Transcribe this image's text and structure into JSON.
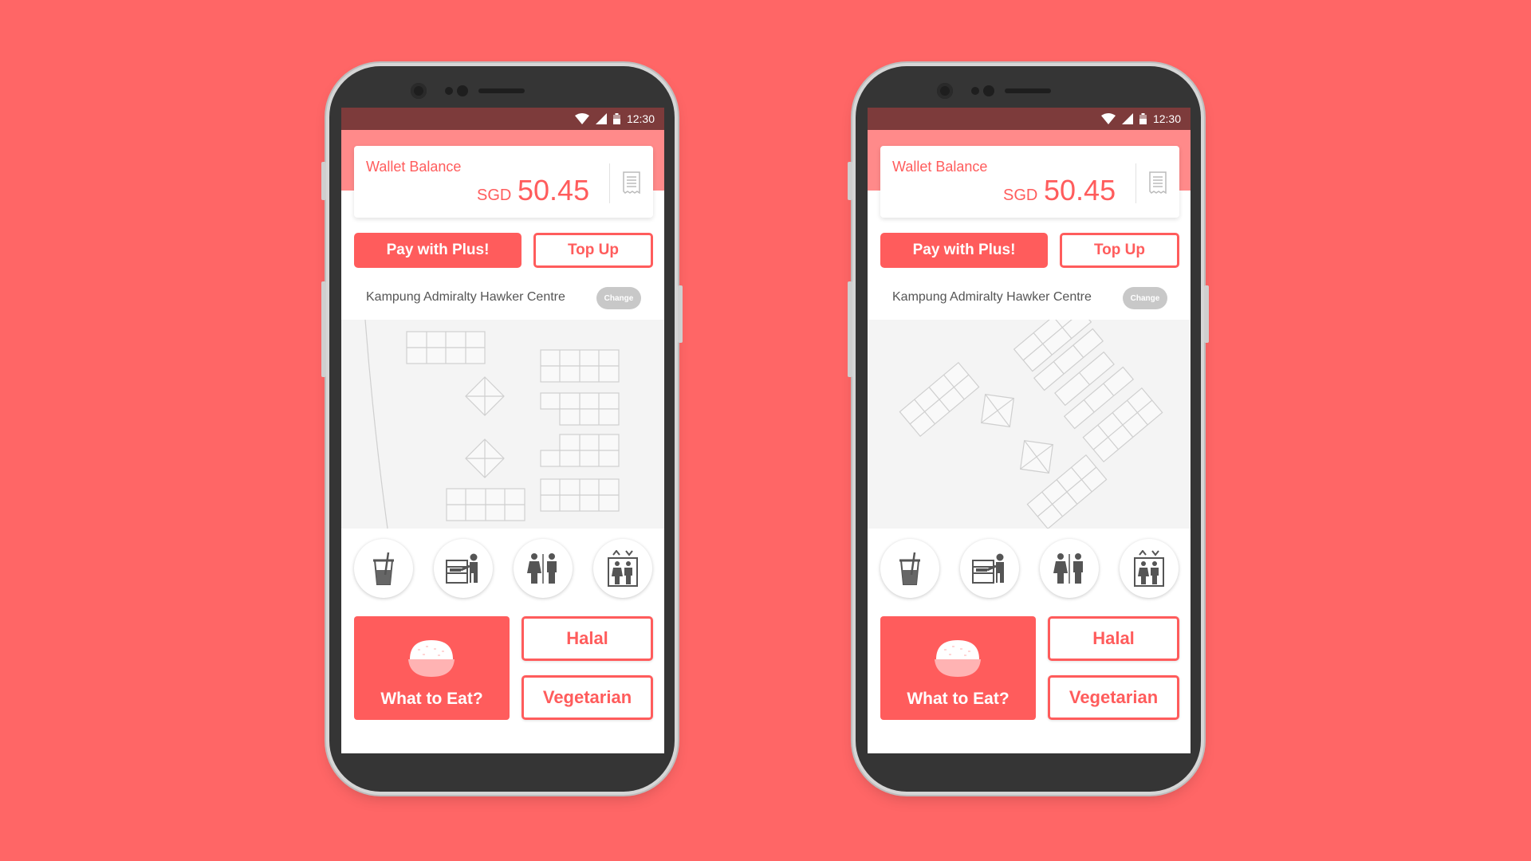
{
  "status_bar": {
    "time": "12:30"
  },
  "wallet": {
    "title": "Wallet Balance",
    "currency": "SGD",
    "amount": "50.45",
    "icon": "receipt-icon"
  },
  "actions": {
    "pay_label": "Pay with Plus!",
    "topup_label": "Top Up"
  },
  "venue": {
    "name": "Kampung Admiralty Hawker Centre",
    "change_label": "Change"
  },
  "amenities": [
    {
      "icon": "drink-cup-icon"
    },
    {
      "icon": "tray-return-icon"
    },
    {
      "icon": "restroom-icon"
    },
    {
      "icon": "lift-icon"
    }
  ],
  "food": {
    "what_to_eat_label": "What to Eat?",
    "halal_label": "Halal",
    "vegetarian_label": "Vegetarian"
  },
  "colors": {
    "background": "#ff6666",
    "accent": "#ff5c5c",
    "status_bar": "#7d3b3b",
    "header_band": "#ff8a8a"
  },
  "screens": [
    {
      "map_view": "plan"
    },
    {
      "map_view": "rotated"
    }
  ]
}
